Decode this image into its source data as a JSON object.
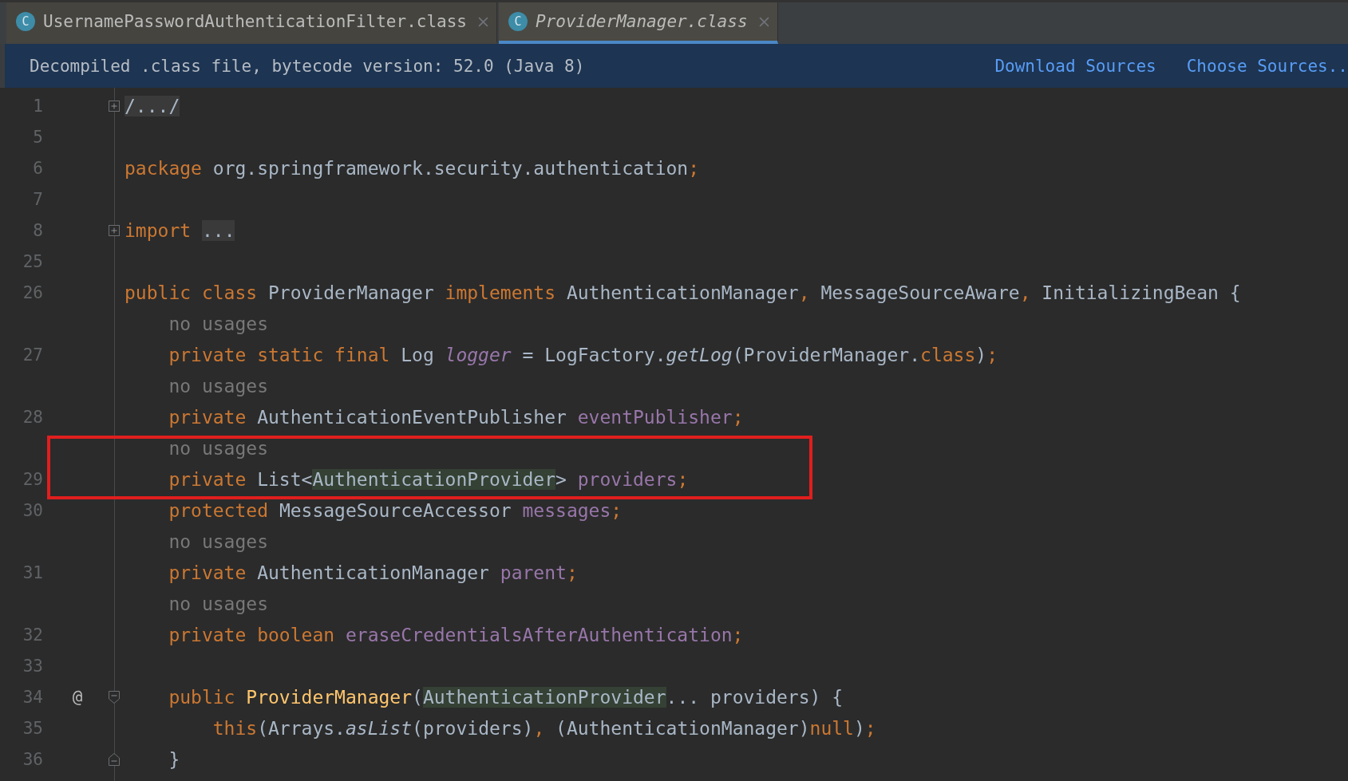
{
  "tabs": [
    {
      "icon_letter": "C",
      "label": "UsernamePasswordAuthenticationFilter.class",
      "selected": false
    },
    {
      "icon_letter": "C",
      "label": "ProviderManager.class",
      "selected": true
    }
  ],
  "banner": {
    "message": "Decompiled .class file, bytecode version: 52.0 (Java 8)",
    "links": [
      "Download Sources",
      "Choose Sources.."
    ]
  },
  "annotation_frame": true,
  "lines": [
    {
      "number": "1",
      "kind": "collapsed",
      "tokens": [
        {
          "text": "/.../",
          "kind": "folded"
        }
      ]
    },
    {
      "number": "5",
      "kind": "blank"
    },
    {
      "number": "6",
      "kind": "code",
      "tokens": [
        {
          "text": "package ",
          "kind": "keyword"
        },
        {
          "text": "org.springframework.security.authentication",
          "kind": "plain"
        },
        {
          "text": ";",
          "kind": "keyword"
        }
      ]
    },
    {
      "number": "7",
      "kind": "blank"
    },
    {
      "number": "8",
      "kind": "collapsed",
      "tokens": [
        {
          "text": "import ",
          "kind": "keyword"
        },
        {
          "text": "...",
          "kind": "folded"
        }
      ]
    },
    {
      "number": "25",
      "kind": "blank"
    },
    {
      "number": "26",
      "kind": "code",
      "tokens": [
        {
          "text": "public class ",
          "kind": "keyword"
        },
        {
          "text": "ProviderManager ",
          "kind": "plain"
        },
        {
          "text": "implements ",
          "kind": "keyword"
        },
        {
          "text": "AuthenticationManager",
          "kind": "plain"
        },
        {
          "text": ", ",
          "kind": "keyword"
        },
        {
          "text": "MessageSourceAware",
          "kind": "plain"
        },
        {
          "text": ", ",
          "kind": "keyword"
        },
        {
          "text": "InitializingBean {",
          "kind": "plain"
        }
      ]
    },
    {
      "kind": "hint",
      "tokens": [
        {
          "text": "    no usages",
          "kind": "hint"
        }
      ]
    },
    {
      "number": "27",
      "kind": "code",
      "tokens": [
        {
          "text": "    private static final ",
          "kind": "keyword"
        },
        {
          "text": "Log ",
          "kind": "plain"
        },
        {
          "text": "logger",
          "kind": "static_field"
        },
        {
          "text": " = LogFactory.",
          "kind": "plain"
        },
        {
          "text": "getLog",
          "kind": "static_call"
        },
        {
          "text": "(ProviderManager.",
          "kind": "plain"
        },
        {
          "text": "class",
          "kind": "keyword"
        },
        {
          "text": ")",
          "kind": "plain"
        },
        {
          "text": ";",
          "kind": "keyword"
        }
      ]
    },
    {
      "kind": "hint",
      "tokens": [
        {
          "text": "    no usages",
          "kind": "hint"
        }
      ]
    },
    {
      "number": "28",
      "kind": "code",
      "tokens": [
        {
          "text": "    private ",
          "kind": "keyword"
        },
        {
          "text": "AuthenticationEventPublisher ",
          "kind": "plain"
        },
        {
          "text": "eventPublisher",
          "kind": "field"
        },
        {
          "text": ";",
          "kind": "keyword"
        }
      ]
    },
    {
      "kind": "hint",
      "tokens": [
        {
          "text": "    no usages",
          "kind": "hint"
        }
      ]
    },
    {
      "number": "29",
      "kind": "code",
      "tokens": [
        {
          "text": "    private ",
          "kind": "keyword"
        },
        {
          "text": "List<",
          "kind": "plain"
        },
        {
          "text": "AuthenticationProvider",
          "kind": "highlight"
        },
        {
          "text": "> ",
          "kind": "plain"
        },
        {
          "text": "providers",
          "kind": "field"
        },
        {
          "text": ";",
          "kind": "keyword"
        }
      ]
    },
    {
      "number": "30",
      "kind": "code",
      "tokens": [
        {
          "text": "    protected ",
          "kind": "keyword"
        },
        {
          "text": "MessageSourceAccessor ",
          "kind": "plain"
        },
        {
          "text": "messages",
          "kind": "field"
        },
        {
          "text": ";",
          "kind": "keyword"
        }
      ]
    },
    {
      "kind": "hint",
      "tokens": [
        {
          "text": "    no usages",
          "kind": "hint"
        }
      ]
    },
    {
      "number": "31",
      "kind": "code",
      "tokens": [
        {
          "text": "    private ",
          "kind": "keyword"
        },
        {
          "text": "AuthenticationManager ",
          "kind": "plain"
        },
        {
          "text": "parent",
          "kind": "field"
        },
        {
          "text": ";",
          "kind": "keyword"
        }
      ]
    },
    {
      "kind": "hint",
      "tokens": [
        {
          "text": "    no usages",
          "kind": "hint"
        }
      ]
    },
    {
      "number": "32",
      "kind": "code",
      "tokens": [
        {
          "text": "    private boolean ",
          "kind": "keyword"
        },
        {
          "text": "eraseCredentialsAfterAuthentication",
          "kind": "field"
        },
        {
          "text": ";",
          "kind": "keyword"
        }
      ]
    },
    {
      "number": "33",
      "kind": "blank"
    },
    {
      "number": "34",
      "kind": "fold_start",
      "gutter_mark": "@",
      "tokens": [
        {
          "text": "    public ",
          "kind": "keyword"
        },
        {
          "text": "ProviderManager",
          "kind": "method"
        },
        {
          "text": "(",
          "kind": "plain"
        },
        {
          "text": "AuthenticationProvider",
          "kind": "highlight"
        },
        {
          "text": "... providers) {",
          "kind": "plain"
        }
      ]
    },
    {
      "number": "35",
      "kind": "code",
      "tokens": [
        {
          "text": "        this",
          "kind": "keyword"
        },
        {
          "text": "(Arrays.",
          "kind": "plain"
        },
        {
          "text": "asList",
          "kind": "static_call"
        },
        {
          "text": "(providers)",
          "kind": "plain"
        },
        {
          "text": ", ",
          "kind": "keyword"
        },
        {
          "text": "(AuthenticationManager)",
          "kind": "plain"
        },
        {
          "text": "null",
          "kind": "keyword"
        },
        {
          "text": ")",
          "kind": "plain"
        },
        {
          "text": ";",
          "kind": "keyword"
        }
      ]
    },
    {
      "number": "36",
      "kind": "fold_end",
      "tokens": [
        {
          "text": "    }",
          "kind": "plain"
        }
      ]
    }
  ]
}
